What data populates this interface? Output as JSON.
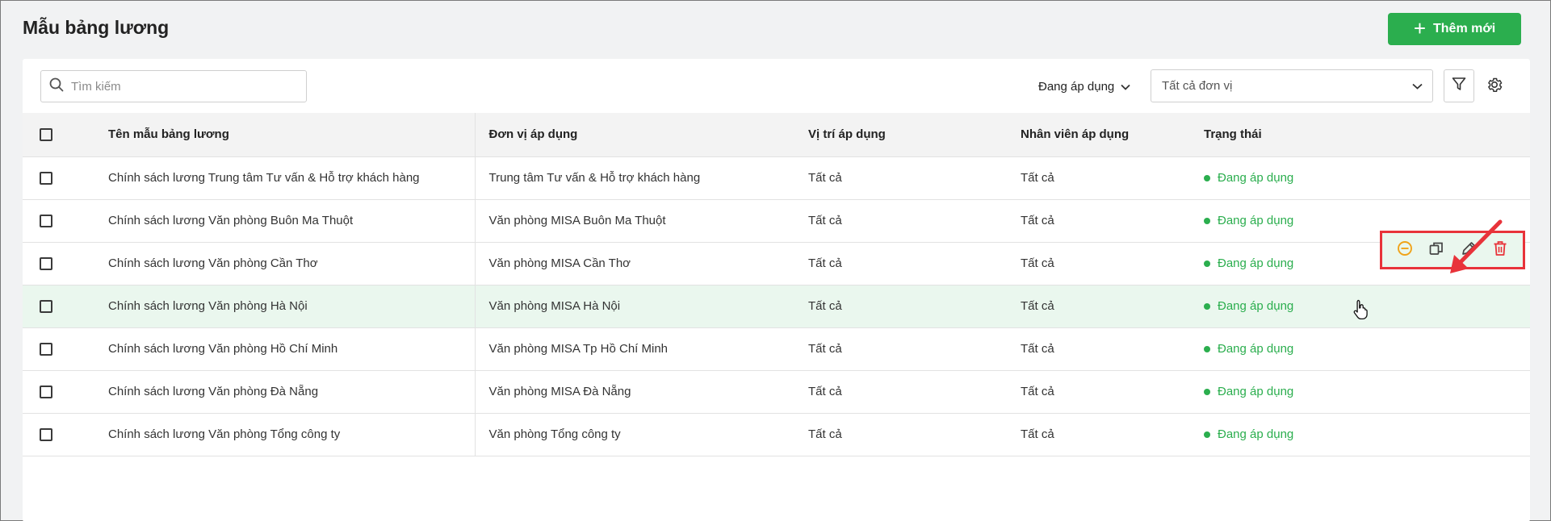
{
  "page": {
    "title": "Mẫu bảng lương",
    "add_button_label": "Thêm mới"
  },
  "toolbar": {
    "search_placeholder": "Tìm kiếm",
    "status_filter_label": "Đang áp dụng",
    "unit_select_value": "Tất cả đơn vị"
  },
  "table": {
    "columns": [
      "Tên mẫu bảng lương",
      "Đơn vị áp dụng",
      "Vị trí áp dụng",
      "Nhân viên áp dụng",
      "Trạng thái"
    ],
    "rows": [
      {
        "name": "Chính sách lương Trung tâm Tư vấn & Hỗ trợ khách hàng",
        "unit": "Trung tâm Tư vấn & Hỗ trợ khách hàng",
        "position": "Tất cả",
        "employees": "Tất cả",
        "status": "Đang áp dụng"
      },
      {
        "name": "Chính sách lương Văn phòng Buôn Ma Thuột",
        "unit": "Văn phòng MISA Buôn Ma Thuột",
        "position": "Tất cả",
        "employees": "Tất cả",
        "status": "Đang áp dụng"
      },
      {
        "name": "Chính sách lương Văn phòng Cần Thơ",
        "unit": "Văn phòng MISA Cần Thơ",
        "position": "Tất cả",
        "employees": "Tất cả",
        "status": "Đang áp dụng"
      },
      {
        "name": "Chính sách lương Văn phòng Hà Nội",
        "unit": "Văn phòng MISA Hà Nội",
        "position": "Tất cả",
        "employees": "Tất cả",
        "status": "Đang áp dụng"
      },
      {
        "name": "Chính sách lương Văn phòng Hồ Chí Minh",
        "unit": "Văn phòng MISA Tp Hồ Chí Minh",
        "position": "Tất cả",
        "employees": "Tất cả",
        "status": "Đang áp dụng"
      },
      {
        "name": "Chính sách lương Văn phòng Đà Nẵng",
        "unit": "Văn phòng MISA Đà Nẵng",
        "position": "Tất cả",
        "employees": "Tất cả",
        "status": "Đang áp dụng"
      },
      {
        "name": "Chính sách lương Văn phòng Tổng công ty",
        "unit": "Văn phòng Tổng công ty",
        "position": "Tất cả",
        "employees": "Tất cả",
        "status": "Đang áp dụng"
      }
    ],
    "hovered_row_index": 3
  },
  "row_actions": {
    "icons": [
      "stop-apply-icon",
      "copy-icon",
      "edit-icon",
      "delete-icon"
    ]
  },
  "colors": {
    "accent": "#2bae4e",
    "status_active": "#2bae4e",
    "stop_icon": "#f0a31a",
    "delete_icon": "#e8333a",
    "annotation": "#e8333a",
    "hover_row": "#eaf7ee"
  }
}
